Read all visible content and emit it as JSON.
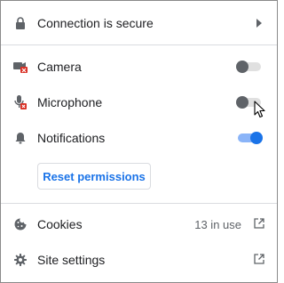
{
  "header": {
    "label": "Connection is secure",
    "icon": "lock-icon"
  },
  "permissions": [
    {
      "label": "Camera",
      "icon": "camera-blocked-icon",
      "enabled": false
    },
    {
      "label": "Microphone",
      "icon": "microphone-blocked-icon",
      "enabled": false
    },
    {
      "label": "Notifications",
      "icon": "bell-icon",
      "enabled": true
    }
  ],
  "reset_button": {
    "label": "Reset permissions"
  },
  "footer": {
    "cookies": {
      "label": "Cookies",
      "meta": "13 in use",
      "icon": "cookie-icon"
    },
    "site_settings": {
      "label": "Site settings",
      "icon": "gear-icon"
    }
  },
  "colors": {
    "accent": "#1a73e8",
    "icon_gray": "#5f6368",
    "blocked_red": "#d93025"
  }
}
